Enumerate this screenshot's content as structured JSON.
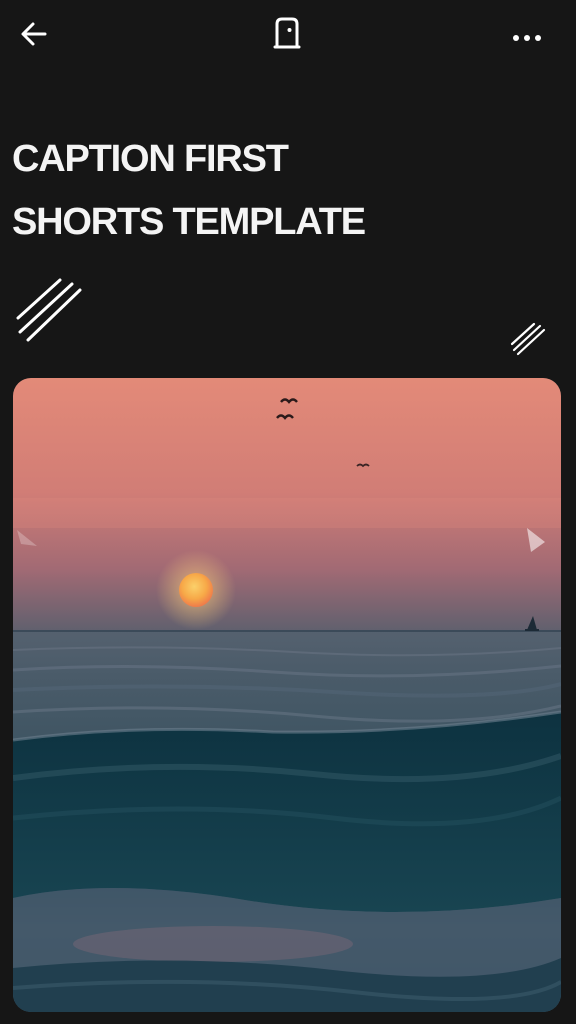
{
  "toolbar": {
    "back_icon": "arrow-left-icon",
    "save_icon": "bookmark-icon",
    "more_icon": "more-horizontal-icon"
  },
  "title": {
    "line1": "CAPTION FIRST",
    "line2": "SHORTS TEMPLATE"
  },
  "photo": {
    "subject": "sunset-over-ocean-waves",
    "colors": {
      "sky_top": "#e38a78",
      "sky_mid": "#c67574",
      "horizon": "#4f5a6a",
      "sun": "#f7a948",
      "sea_deep": "#0e3440",
      "sea_light": "#5d6d7e"
    }
  },
  "theme": {
    "background": "#161616",
    "text": "#f4f4f4"
  }
}
